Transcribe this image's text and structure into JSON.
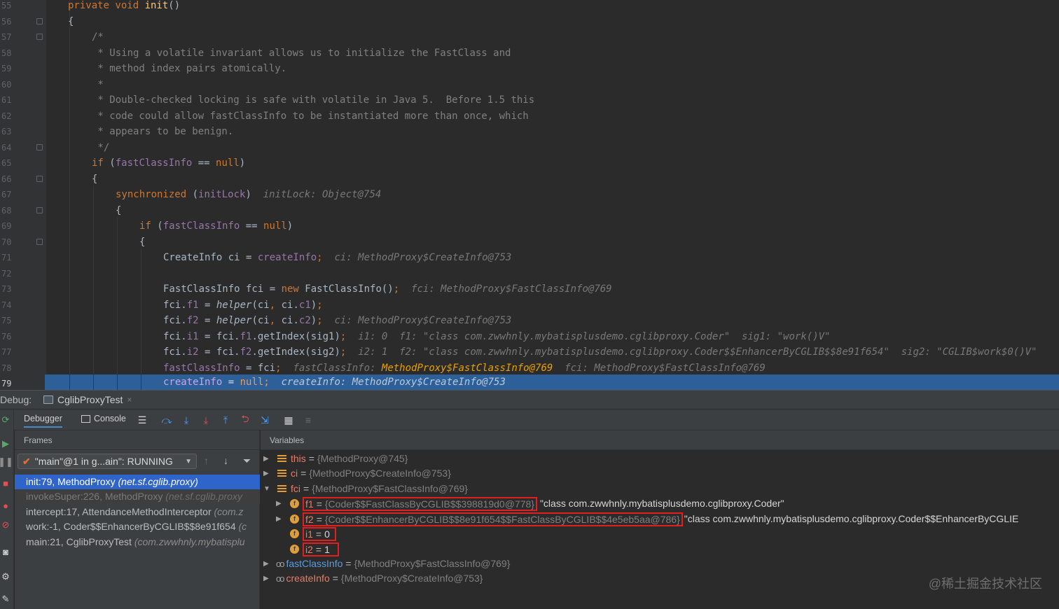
{
  "editor": {
    "lines": [
      {
        "num": "55"
      },
      {
        "num": "56"
      },
      {
        "num": "57"
      },
      {
        "num": "58"
      },
      {
        "num": "59"
      },
      {
        "num": "60"
      },
      {
        "num": "61"
      },
      {
        "num": "62"
      },
      {
        "num": "63"
      },
      {
        "num": "64"
      },
      {
        "num": "65"
      },
      {
        "num": "66"
      },
      {
        "num": "67"
      },
      {
        "num": "68"
      },
      {
        "num": "69"
      },
      {
        "num": "70"
      },
      {
        "num": "71"
      },
      {
        "num": "72"
      },
      {
        "num": "73"
      },
      {
        "num": "74"
      },
      {
        "num": "75"
      },
      {
        "num": "76"
      },
      {
        "num": "77"
      },
      {
        "num": "78"
      },
      {
        "num": "79"
      }
    ],
    "code": {
      "l55_kw": "private void ",
      "l55_fn": "init",
      "l55_rest": "()",
      "l56": "{",
      "l57": "/*",
      "l58": " * Using a volatile invariant allows us to initialize the FastClass and",
      "l59": " * method index pairs atomically.",
      "l60": " *",
      "l61": " * Double-checked locking is safe with volatile in Java 5.  Before 1.5 this",
      "l62": " * code could allow fastClassInfo to be instantiated more than once, which",
      "l63": " * appears to be benign.",
      "l64": " */",
      "l65_kw": "if ",
      "l65_a": "(",
      "l65_f": "fastClassInfo",
      "l65_b": " == ",
      "l65_null": "null",
      "l65_c": ")",
      "l66": "{",
      "l67_kw": "synchronized ",
      "l67_a": "(",
      "l67_f": "initLock",
      "l67_b": ")",
      "l67_hint": "initLock: Object@754",
      "l68": "{",
      "l69_kw": "if ",
      "l69_a": "(",
      "l69_f": "fastClassInfo",
      "l69_b": " == ",
      "l69_null": "null",
      "l69_c": ")",
      "l70": "{",
      "l71_a": "CreateInfo ci = ",
      "l71_f": "createInfo",
      "l71_b": ";",
      "l71_hint": "ci: MethodProxy$CreateInfo@753",
      "l73_a": "FastClassInfo fci = ",
      "l73_kw": "new ",
      "l73_b": "FastClassInfo()",
      "l73_c": ";",
      "l73_hint": "fci: MethodProxy$FastClassInfo@769",
      "l74_a": "fci.",
      "l74_f": "f1",
      "l74_b": " = ",
      "l74_fn": "helper",
      "l74_c": "(ci",
      "l74_d": ", ",
      "l74_e": "ci.",
      "l74_g": "c1",
      "l74_h": ")",
      "l74_i": ";",
      "l75_a": "fci.",
      "l75_f": "f2",
      "l75_b": " = ",
      "l75_fn": "helper",
      "l75_c": "(ci",
      "l75_d": ", ",
      "l75_e": "ci.",
      "l75_g": "c2",
      "l75_h": ")",
      "l75_i": ";",
      "l75_hint": "ci: MethodProxy$CreateInfo@753",
      "l76_a": "fci.",
      "l76_f": "i1",
      "l76_b": " = fci.",
      "l76_g": "f1",
      "l76_c": ".getIndex(sig1)",
      "l76_i": ";",
      "l76_hint": "i1: 0  f1: \"class com.zwwhnly.mybatisplusdemo.cglibproxy.Coder\"  sig1: \"work()V\"",
      "l77_a": "fci.",
      "l77_f": "i2",
      "l77_b": " = fci.",
      "l77_g": "f2",
      "l77_c": ".getIndex(sig2)",
      "l77_i": ";",
      "l77_hint": "i2: 1  f2: \"class com.zwwhnly.mybatisplusdemo.cglibproxy.Coder$$EnhancerByCGLIB$$8e91f654\"  sig2: \"CGLIB$work$0()V\"",
      "l78_f": "fastClassInfo",
      "l78_a": " = fci",
      "l78_i": ";",
      "l78_hint_a": "fastClassInfo: ",
      "l78_hint_b": "MethodProxy$FastClassInfo@769",
      "l78_hint_c": "  fci: MethodProxy$FastClassInfo@769",
      "l79_f": "createInfo",
      "l79_a": " = ",
      "l79_null": "null",
      "l79_i": ";",
      "l79_hint": "createInfo: MethodProxy$CreateInfo@753"
    }
  },
  "debug": {
    "label": "Debug:",
    "tab_title": "CglibProxyTest",
    "toolbar": {
      "debugger": "Debugger",
      "console": "Console"
    },
    "frames": {
      "header": "Frames",
      "thread": "\"main\"@1 in g...ain\": RUNNING",
      "items": [
        {
          "method": "init:79, MethodProxy ",
          "pkg": "(net.sf.cglib.proxy)"
        },
        {
          "method": "invokeSuper:226, MethodProxy ",
          "pkg": "(net.sf.cglib.proxy"
        },
        {
          "method": "intercept:17, AttendanceMethodInterceptor ",
          "pkg": "(com.z"
        },
        {
          "method": "work:-1, Coder$$EnhancerByCGLIB$$8e91f654 ",
          "pkg": "(c"
        },
        {
          "method": "main:21, CglibProxyTest ",
          "pkg": "(com.zwwhnly.mybatisplu"
        }
      ]
    },
    "variables": {
      "header": "Variables",
      "items": [
        {
          "name": "this",
          "value": "{MethodProxy@745}"
        },
        {
          "name": "ci",
          "value": "{MethodProxy$CreateInfo@753}"
        },
        {
          "name": "fci",
          "value": "{MethodProxy$FastClassInfo@769}"
        },
        {
          "name": "f1",
          "value": "{Coder$$FastClassByCGLIB$$398819d0@778}",
          "str": "\"class com.zwwhnly.mybatisplusdemo.cglibproxy.Coder\""
        },
        {
          "name": "f2",
          "value": "{Coder$$EnhancerByCGLIB$$8e91f654$$FastClassByCGLIB$$4e5eb5aa@786}",
          "str": "\"class com.zwwhnly.mybatisplusdemo.cglibproxy.Coder$$EnhancerByCGLIE"
        },
        {
          "name": "i1",
          "value": "0"
        },
        {
          "name": "i2",
          "value": "1"
        },
        {
          "name": "fastClassInfo",
          "value": "{MethodProxy$FastClassInfo@769}"
        },
        {
          "name": "createInfo",
          "value": "{MethodProxy$CreateInfo@753}"
        }
      ]
    }
  },
  "watermark": "@稀土掘金技术社区",
  "colors": {
    "current_line": "#2d6099",
    "selected_frame": "#2f65ca",
    "highlight_box": "#e02020",
    "keyword": "#cc7832"
  }
}
